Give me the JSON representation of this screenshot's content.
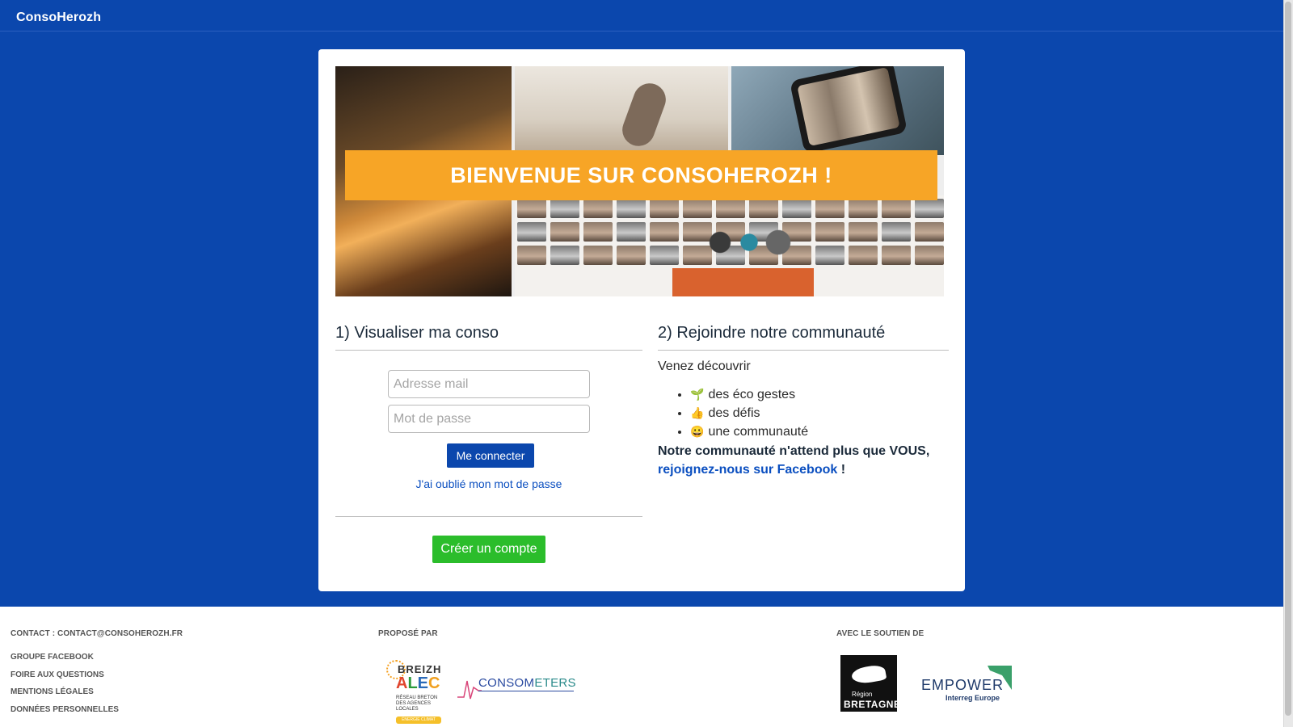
{
  "app": {
    "brand": "ConsoHerozh"
  },
  "banner": {
    "title": "BIENVENUE SUR CONSOHEROZH !"
  },
  "login": {
    "title": "1) Visualiser ma conso",
    "email_placeholder": "Adresse mail",
    "password_placeholder": "Mot de passe",
    "submit_label": "Me connecter",
    "forgot_label": "J'ai oublié mon mot de passe",
    "create_label": "Créer un compte"
  },
  "community": {
    "title": "2) Rejoindre notre communauté",
    "intro": "Venez découvrir",
    "items": [
      {
        "icon": "seedling-icon",
        "glyph": "🌱",
        "label": "des éco gestes"
      },
      {
        "icon": "thumbs-up-icon",
        "glyph": "👍",
        "label": "des défis"
      },
      {
        "icon": "smile-icon",
        "glyph": "😀",
        "label": "une communauté"
      }
    ],
    "cta_text": "Notre communauté n'attend plus que VOUS,",
    "cta_link": "rejoignez-nous sur Facebook",
    "cta_suffix": " !"
  },
  "footer": {
    "contact": "CONTACT : CONTACT@CONSOHEROZH.FR",
    "links": [
      "GROUPE FACEBOOK",
      "FOIRE AUX QUESTIONS",
      "MENTIONS LÉGALES",
      "DONNÉES PERSONNELLES"
    ],
    "proposed_by": "PROPOSÉ PAR",
    "supported_by": "AVEC LE SOUTIEN DE",
    "logos": {
      "breizh_top": "BREIZH",
      "breizh_alec": [
        "A",
        "L",
        "E",
        "C"
      ],
      "breizh_sub": "RÉSEAU BRETON DES AGENCES LOCALES",
      "breizh_tag": "ÉNERGIE CLIMAT",
      "conso_a": "CONSOM",
      "conso_b": "ETERS",
      "bretagne_region": "Région",
      "bretagne_name": "BRETAGNE",
      "empower_name": "EMPOWER",
      "empower_sub": "Interreg Europe"
    }
  },
  "colors": {
    "primary": "#0b47ad",
    "banner_strip": "#f7a526",
    "success": "#2bbd2b",
    "link": "#0b4fc0"
  }
}
